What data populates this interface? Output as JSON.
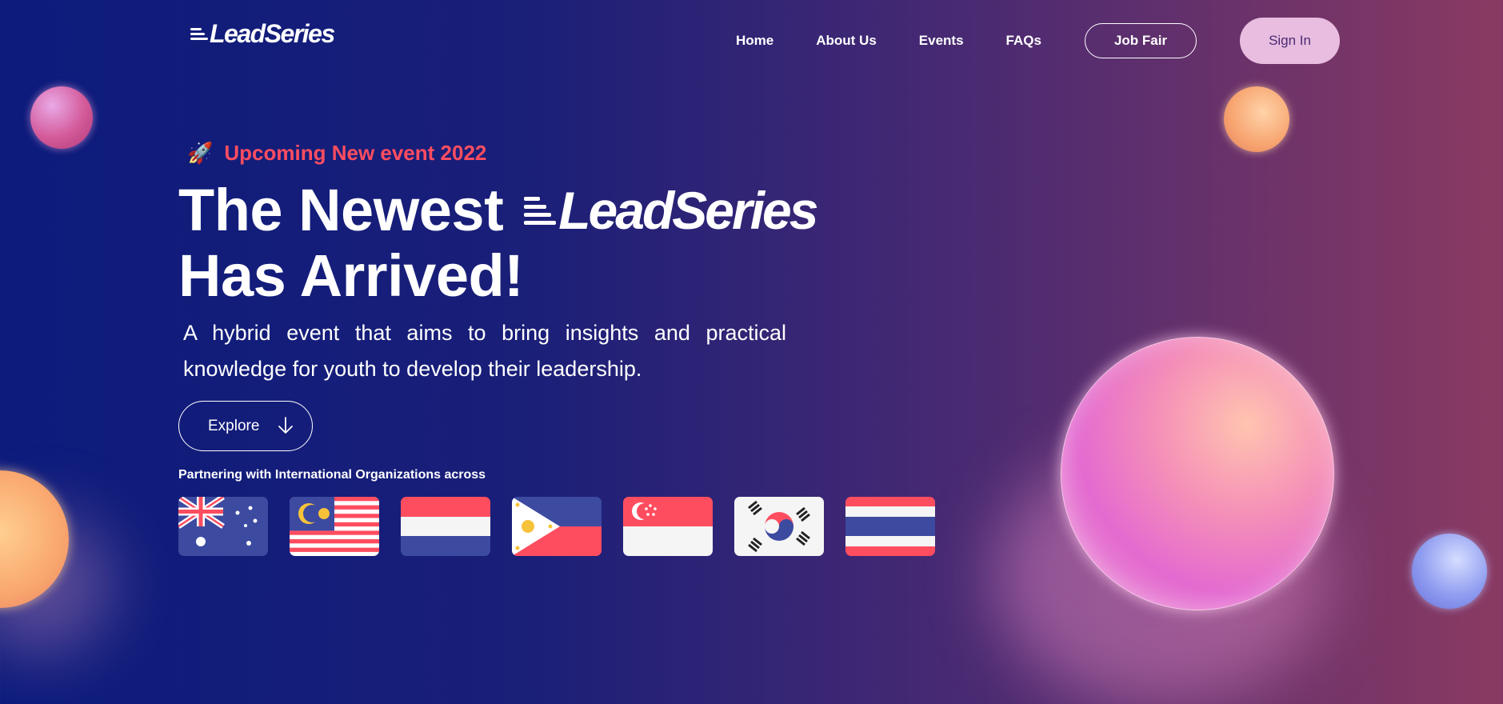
{
  "nav": {
    "logo": "LeadSeries",
    "links": [
      "Home",
      "About Us",
      "Events",
      "FAQs"
    ],
    "job_fair": "Job Fair",
    "sign_in": "Sign In"
  },
  "hero": {
    "tag_icon": "rocket-icon",
    "tag": "Upcoming New event 2022",
    "headline_1": "The Newest",
    "headline_logo": "LeadSeries",
    "headline_2": "Has Arrived!",
    "description": "A hybrid event that aims to bring insights and practical knowledge for youth to develop their leadership.",
    "explore": "Explore",
    "partner_text": "Partnering with International Organizations across"
  },
  "flags": [
    "australia-flag-icon",
    "malaysia-flag-icon",
    "netherlands-flag-icon",
    "philippines-flag-icon",
    "singapore-flag-icon",
    "south-korea-flag-icon",
    "thailand-flag-icon"
  ],
  "colors": {
    "accent": "#ff4d60",
    "sign_in_bg": "#e8bde0",
    "bg_left": "#0c1b7c",
    "bg_right": "#8a3a62"
  }
}
